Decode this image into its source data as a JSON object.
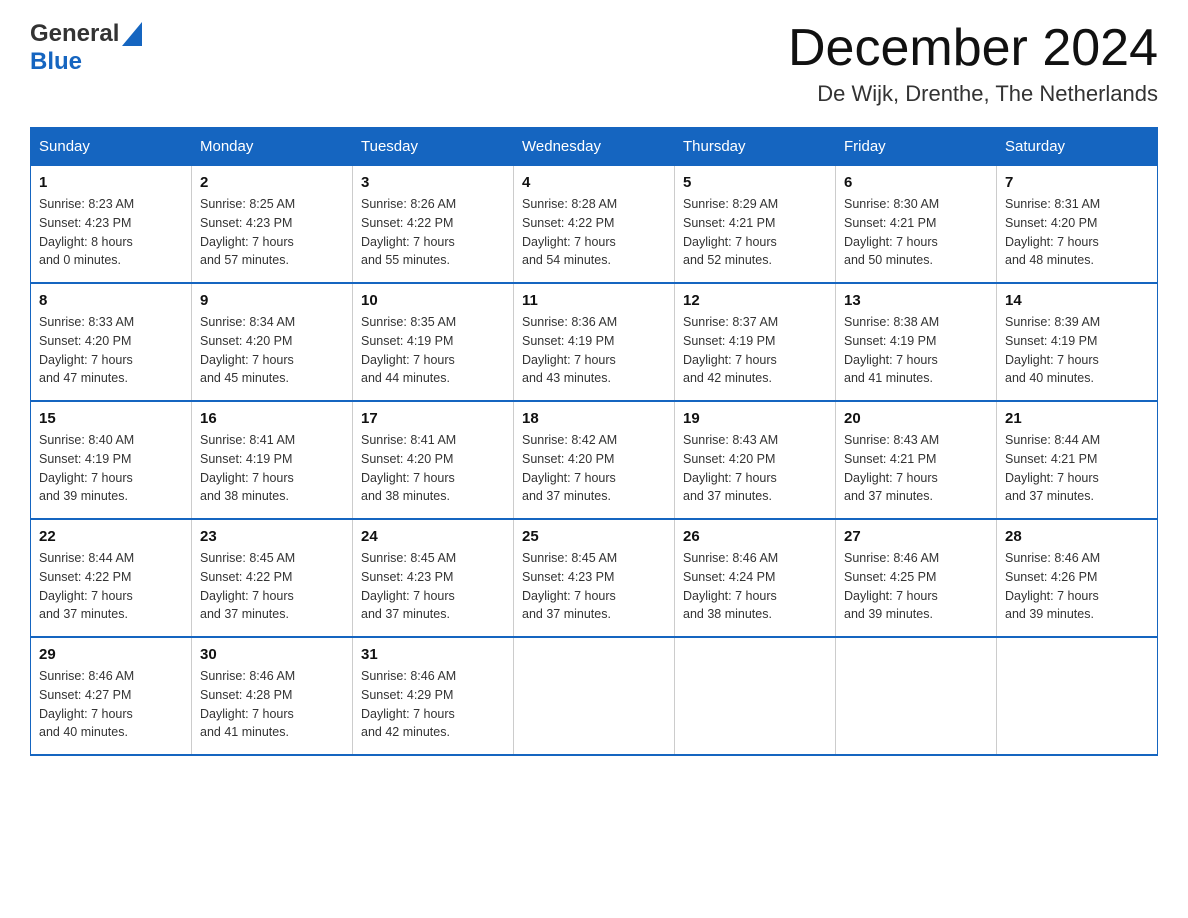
{
  "header": {
    "logo_general": "General",
    "logo_blue": "Blue",
    "month_title": "December 2024",
    "location": "De Wijk, Drenthe, The Netherlands"
  },
  "days_of_week": [
    "Sunday",
    "Monday",
    "Tuesday",
    "Wednesday",
    "Thursday",
    "Friday",
    "Saturday"
  ],
  "weeks": [
    [
      {
        "day": "1",
        "info": "Sunrise: 8:23 AM\nSunset: 4:23 PM\nDaylight: 8 hours\nand 0 minutes."
      },
      {
        "day": "2",
        "info": "Sunrise: 8:25 AM\nSunset: 4:23 PM\nDaylight: 7 hours\nand 57 minutes."
      },
      {
        "day": "3",
        "info": "Sunrise: 8:26 AM\nSunset: 4:22 PM\nDaylight: 7 hours\nand 55 minutes."
      },
      {
        "day": "4",
        "info": "Sunrise: 8:28 AM\nSunset: 4:22 PM\nDaylight: 7 hours\nand 54 minutes."
      },
      {
        "day": "5",
        "info": "Sunrise: 8:29 AM\nSunset: 4:21 PM\nDaylight: 7 hours\nand 52 minutes."
      },
      {
        "day": "6",
        "info": "Sunrise: 8:30 AM\nSunset: 4:21 PM\nDaylight: 7 hours\nand 50 minutes."
      },
      {
        "day": "7",
        "info": "Sunrise: 8:31 AM\nSunset: 4:20 PM\nDaylight: 7 hours\nand 48 minutes."
      }
    ],
    [
      {
        "day": "8",
        "info": "Sunrise: 8:33 AM\nSunset: 4:20 PM\nDaylight: 7 hours\nand 47 minutes."
      },
      {
        "day": "9",
        "info": "Sunrise: 8:34 AM\nSunset: 4:20 PM\nDaylight: 7 hours\nand 45 minutes."
      },
      {
        "day": "10",
        "info": "Sunrise: 8:35 AM\nSunset: 4:19 PM\nDaylight: 7 hours\nand 44 minutes."
      },
      {
        "day": "11",
        "info": "Sunrise: 8:36 AM\nSunset: 4:19 PM\nDaylight: 7 hours\nand 43 minutes."
      },
      {
        "day": "12",
        "info": "Sunrise: 8:37 AM\nSunset: 4:19 PM\nDaylight: 7 hours\nand 42 minutes."
      },
      {
        "day": "13",
        "info": "Sunrise: 8:38 AM\nSunset: 4:19 PM\nDaylight: 7 hours\nand 41 minutes."
      },
      {
        "day": "14",
        "info": "Sunrise: 8:39 AM\nSunset: 4:19 PM\nDaylight: 7 hours\nand 40 minutes."
      }
    ],
    [
      {
        "day": "15",
        "info": "Sunrise: 8:40 AM\nSunset: 4:19 PM\nDaylight: 7 hours\nand 39 minutes."
      },
      {
        "day": "16",
        "info": "Sunrise: 8:41 AM\nSunset: 4:19 PM\nDaylight: 7 hours\nand 38 minutes."
      },
      {
        "day": "17",
        "info": "Sunrise: 8:41 AM\nSunset: 4:20 PM\nDaylight: 7 hours\nand 38 minutes."
      },
      {
        "day": "18",
        "info": "Sunrise: 8:42 AM\nSunset: 4:20 PM\nDaylight: 7 hours\nand 37 minutes."
      },
      {
        "day": "19",
        "info": "Sunrise: 8:43 AM\nSunset: 4:20 PM\nDaylight: 7 hours\nand 37 minutes."
      },
      {
        "day": "20",
        "info": "Sunrise: 8:43 AM\nSunset: 4:21 PM\nDaylight: 7 hours\nand 37 minutes."
      },
      {
        "day": "21",
        "info": "Sunrise: 8:44 AM\nSunset: 4:21 PM\nDaylight: 7 hours\nand 37 minutes."
      }
    ],
    [
      {
        "day": "22",
        "info": "Sunrise: 8:44 AM\nSunset: 4:22 PM\nDaylight: 7 hours\nand 37 minutes."
      },
      {
        "day": "23",
        "info": "Sunrise: 8:45 AM\nSunset: 4:22 PM\nDaylight: 7 hours\nand 37 minutes."
      },
      {
        "day": "24",
        "info": "Sunrise: 8:45 AM\nSunset: 4:23 PM\nDaylight: 7 hours\nand 37 minutes."
      },
      {
        "day": "25",
        "info": "Sunrise: 8:45 AM\nSunset: 4:23 PM\nDaylight: 7 hours\nand 37 minutes."
      },
      {
        "day": "26",
        "info": "Sunrise: 8:46 AM\nSunset: 4:24 PM\nDaylight: 7 hours\nand 38 minutes."
      },
      {
        "day": "27",
        "info": "Sunrise: 8:46 AM\nSunset: 4:25 PM\nDaylight: 7 hours\nand 39 minutes."
      },
      {
        "day": "28",
        "info": "Sunrise: 8:46 AM\nSunset: 4:26 PM\nDaylight: 7 hours\nand 39 minutes."
      }
    ],
    [
      {
        "day": "29",
        "info": "Sunrise: 8:46 AM\nSunset: 4:27 PM\nDaylight: 7 hours\nand 40 minutes."
      },
      {
        "day": "30",
        "info": "Sunrise: 8:46 AM\nSunset: 4:28 PM\nDaylight: 7 hours\nand 41 minutes."
      },
      {
        "day": "31",
        "info": "Sunrise: 8:46 AM\nSunset: 4:29 PM\nDaylight: 7 hours\nand 42 minutes."
      },
      {
        "day": "",
        "info": ""
      },
      {
        "day": "",
        "info": ""
      },
      {
        "day": "",
        "info": ""
      },
      {
        "day": "",
        "info": ""
      }
    ]
  ]
}
